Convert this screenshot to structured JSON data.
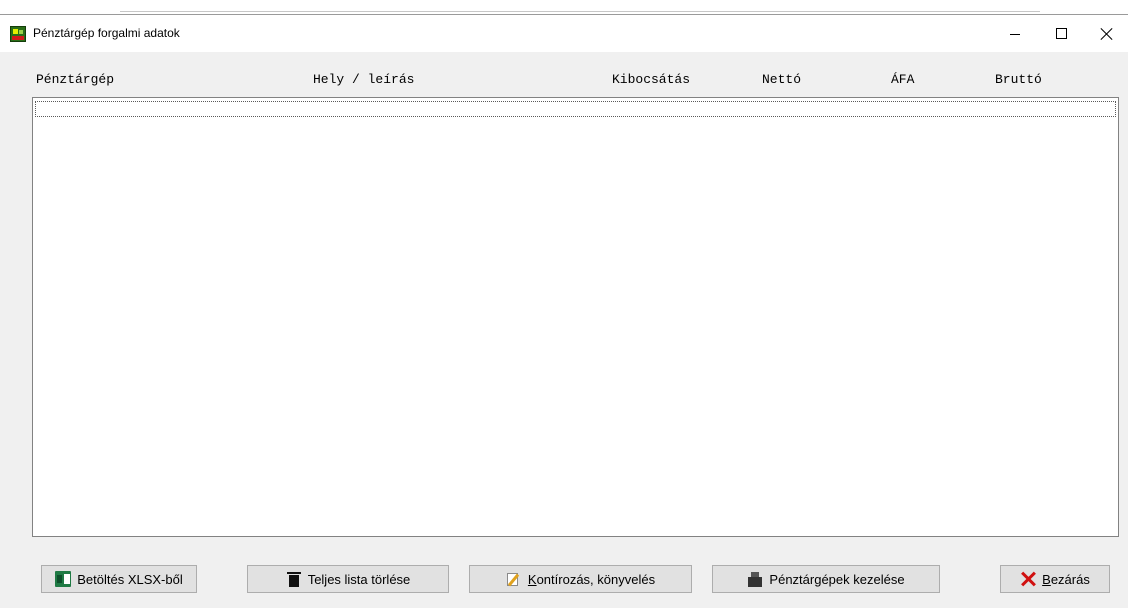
{
  "window": {
    "title": "Pénztárgép forgalmi adatok",
    "icon": "app-icon"
  },
  "columns": [
    "Pénztárgép",
    "Hely / leírás",
    "Kibocsátás",
    "Nettó",
    "ÁFA",
    "Bruttó"
  ],
  "rows": [],
  "buttons": {
    "load_xlsx": {
      "label": "Betöltés XLSX-ből",
      "icon": "excel-icon"
    },
    "clear_list": {
      "label": "Teljes lista törlése",
      "icon": "trash-icon"
    },
    "posting": {
      "label_prefix": "",
      "label_underline": "K",
      "label_rest": "ontírozás, könyvelés",
      "icon": "edit-icon"
    },
    "manage_registers": {
      "label": "Pénztárgépek kezelése",
      "icon": "cash-register-icon"
    },
    "close": {
      "label_prefix": "",
      "label_underline": "B",
      "label_rest": "ezárás",
      "icon": "red-x-icon"
    }
  },
  "colors": {
    "window_bg": "#f0f0f0",
    "list_bg": "#ffffff",
    "button_bg": "#e1e1e1",
    "close_icon": "#d01010"
  }
}
